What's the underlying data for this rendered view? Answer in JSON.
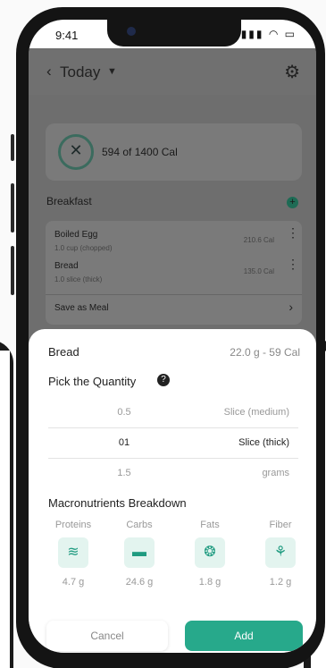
{
  "status_bar": {
    "time": "9:41",
    "icons": "signal wifi battery"
  },
  "header": {
    "title": "Today",
    "back_icon": "chevron-left-icon",
    "dropdown_icon": "caret-down-icon",
    "settings_icon": "gear-icon"
  },
  "calorie_summary": {
    "text": "594 of 1400 Cal",
    "icon": "fork-knife-icon"
  },
  "breakfast": {
    "title": "Breakfast",
    "add_icon": "plus-circle-icon",
    "items": [
      {
        "name": "Boiled Egg",
        "qty": "1.0 cup (chopped)",
        "cal": "210.6 Cal"
      },
      {
        "name": "Bread",
        "qty": "1.0 slice (thick)",
        "cal": "135.0 Cal"
      }
    ],
    "save_as_meal": "Save as Meal"
  },
  "sheet": {
    "food_name": "Bread",
    "food_meta": "22.0 g - 59 Cal",
    "pick_quantity": "Pick the Quantity",
    "help_icon": "question-icon",
    "picker": [
      {
        "value": "0.5",
        "unit": "Slice (medium)"
      },
      {
        "value": "01",
        "unit": "Slice (thick)"
      },
      {
        "value": "1.5",
        "unit": "grams"
      }
    ],
    "picker_selected_index": 1,
    "macros_title": "Macronutrients Breakdown",
    "macros": [
      {
        "label": "Proteins",
        "value": "4.7 g",
        "icon": "dna-icon"
      },
      {
        "label": "Carbs",
        "value": "24.6 g",
        "icon": "bread-icon"
      },
      {
        "label": "Fats",
        "value": "1.8 g",
        "icon": "droplets-icon"
      },
      {
        "label": "Fiber",
        "value": "1.2 g",
        "icon": "wheat-icon"
      }
    ],
    "cancel_label": "Cancel",
    "add_label": "Add"
  },
  "colors": {
    "accent": "#27a98b",
    "tile_bg": "#e3f4ef",
    "overlay": "#6e6e6e"
  }
}
